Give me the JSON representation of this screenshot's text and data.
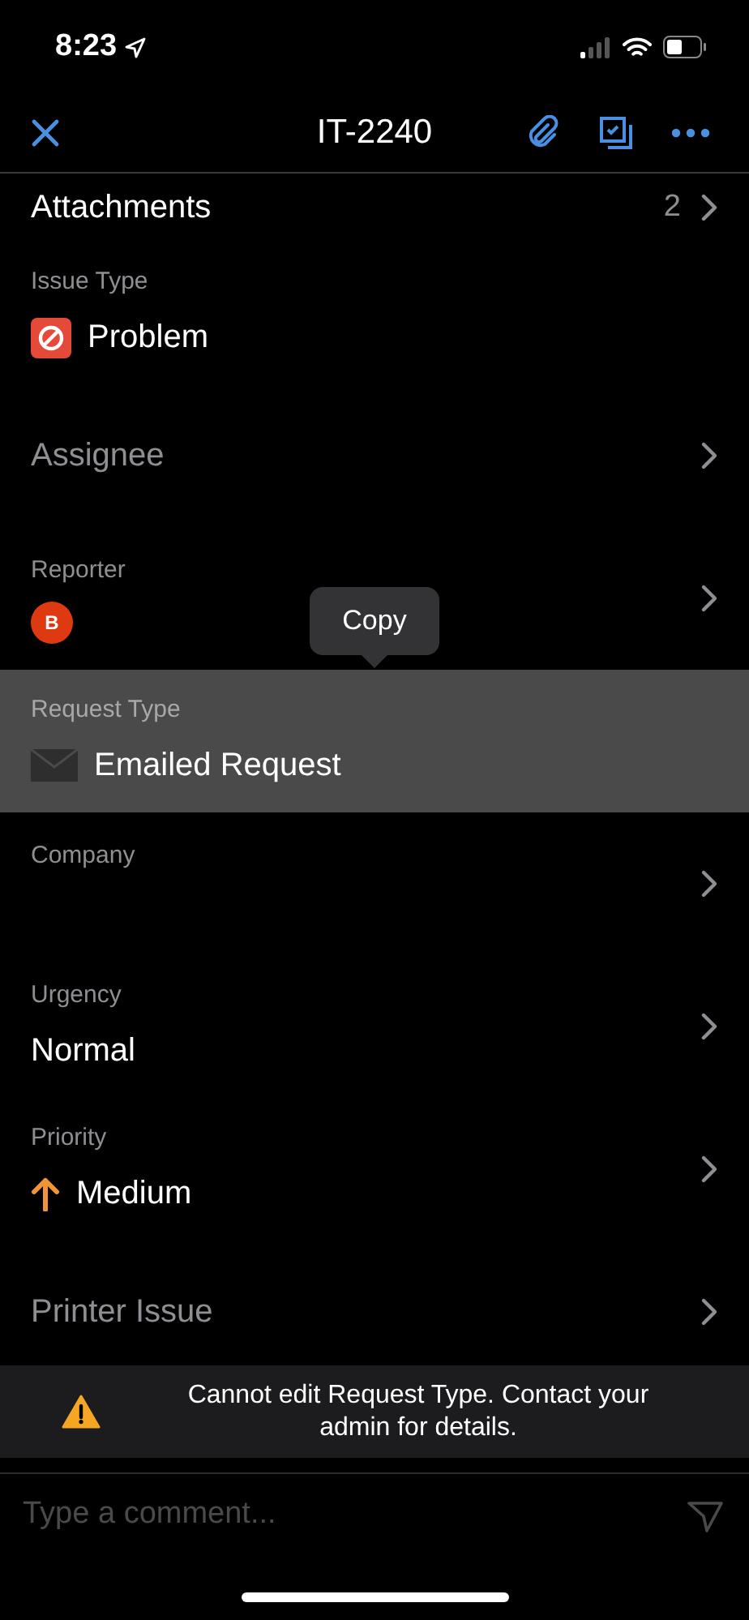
{
  "status_bar": {
    "time": "8:23"
  },
  "header": {
    "title": "IT-2240"
  },
  "fields": [
    {
      "kind": "count",
      "label": "Attachments",
      "count": "2",
      "chevron": true,
      "highlighted": false
    },
    {
      "kind": "value",
      "label": "Issue Type",
      "value": "Problem",
      "chevron": false,
      "highlighted": false
    },
    {
      "kind": "empty",
      "label": "Assignee",
      "chevron": true,
      "highlighted": false
    },
    {
      "kind": "person",
      "label": "Reporter",
      "initial": "B",
      "chevron": true,
      "highlighted": false
    },
    {
      "kind": "value",
      "label": "Request Type",
      "value": "Emailed Request",
      "chevron": false,
      "highlighted": true
    },
    {
      "kind": "value",
      "label": "Company",
      "chevron": true,
      "highlighted": false
    },
    {
      "kind": "value",
      "label": "Urgency",
      "value": "Normal",
      "chevron": true,
      "highlighted": false
    },
    {
      "kind": "value",
      "label": "Priority",
      "value": "Medium",
      "chevron": true,
      "highlighted": false
    },
    {
      "kind": "empty",
      "label": "Printer Issue",
      "chevron": true,
      "highlighted": false
    }
  ],
  "tooltip": {
    "label": "Copy"
  },
  "toast": {
    "message": "Cannot edit Request Type. Contact your admin for details."
  },
  "comment": {
    "placeholder": "Type a comment..."
  }
}
